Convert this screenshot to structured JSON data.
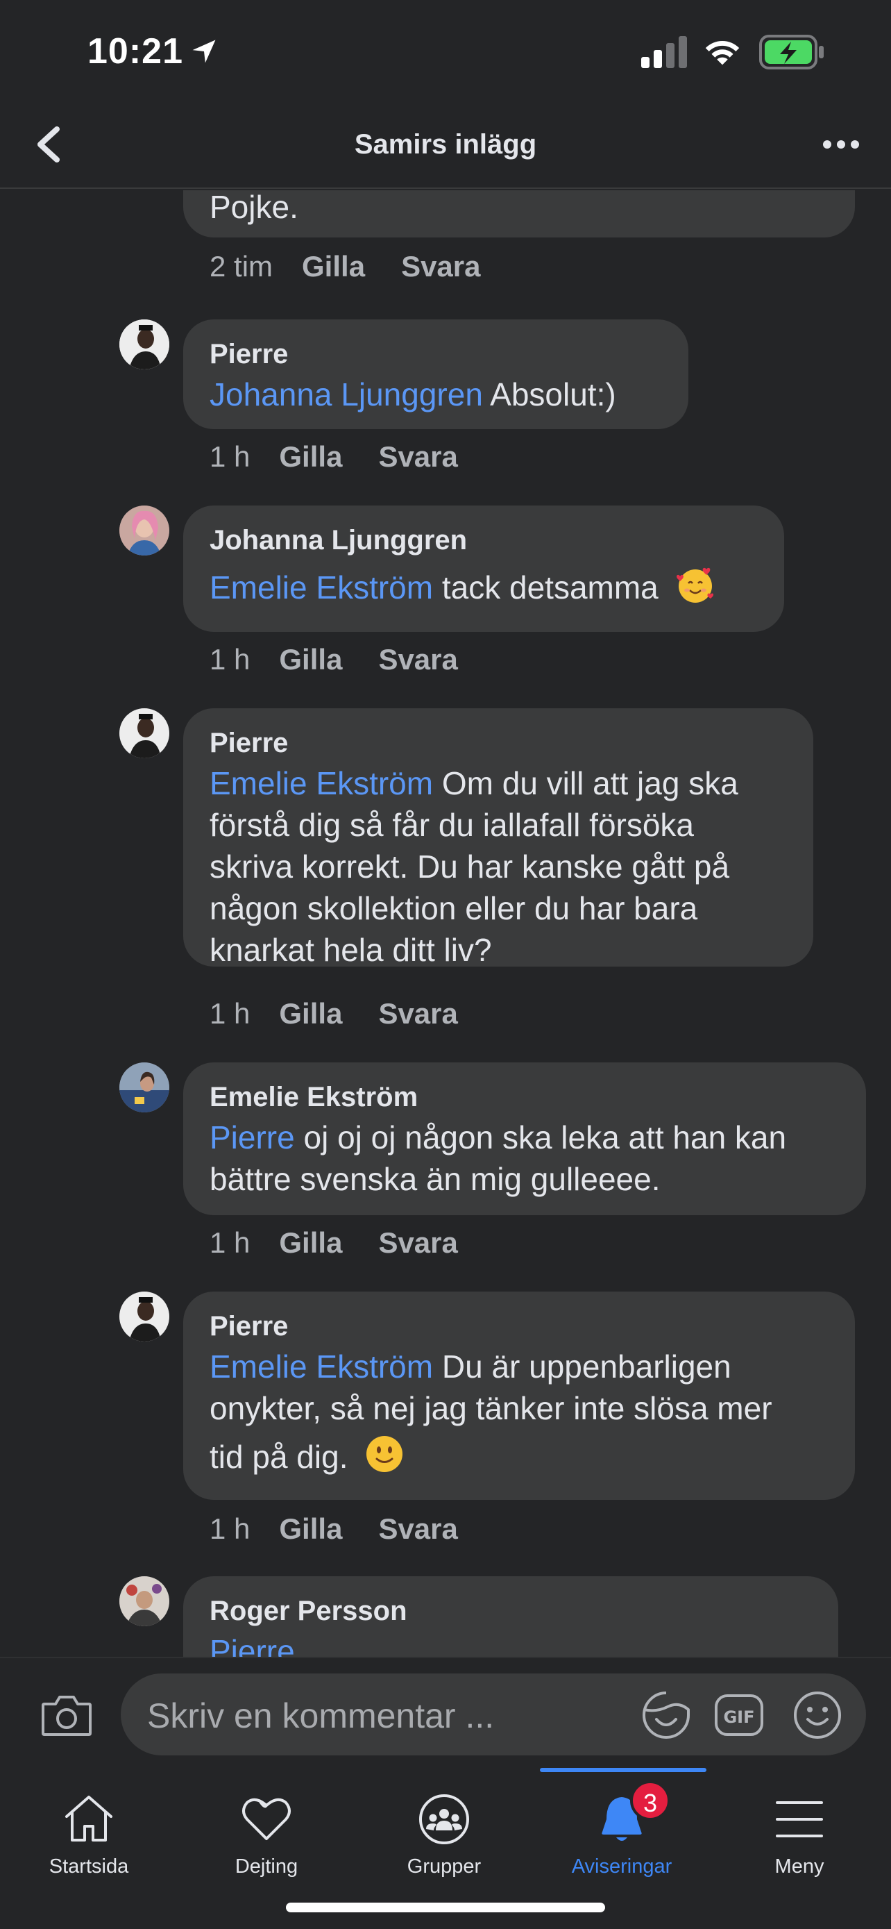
{
  "status_bar": {
    "time": "10:21"
  },
  "header": {
    "title": "Samirs inlägg"
  },
  "comments": [
    {
      "name": "",
      "mention": "",
      "text": "Pojke.",
      "time": "2 tim",
      "like": "Gilla",
      "reply": "Svara"
    },
    {
      "name": "Pierre",
      "mention": "Johanna Ljunggren",
      "text": " Absolut:)",
      "time": "1 h",
      "like": "Gilla",
      "reply": "Svara"
    },
    {
      "name": "Johanna Ljunggren",
      "mention": "Emelie Ekström",
      "text": " tack detsamma",
      "emoji": "smiling-face-with-hearts",
      "time": "1 h",
      "like": "Gilla",
      "reply": "Svara"
    },
    {
      "name": "Pierre",
      "mention": "Emelie Ekström",
      "lines": [
        " Om du vill att jag ska",
        "förstå dig så får du iallafall försöka",
        "skriva korrekt. Du har kanske gått på",
        "någon skollektion eller du har bara",
        "knarkat hela ditt liv?"
      ],
      "time": "1 h",
      "like": "Gilla",
      "reply": "Svara"
    },
    {
      "name": "Emelie Ekström",
      "mention": "Pierre",
      "lines": [
        " oj oj oj någon ska leka att han kan",
        "bättre svenska än mig gulleeee."
      ],
      "time": "1 h",
      "like": "Gilla",
      "reply": "Svara"
    },
    {
      "name": "Pierre",
      "mention": "Emelie Ekström",
      "lines": [
        " Du är uppenbarligen",
        "onykter, så nej jag tänker inte slösa mer",
        "tid på dig."
      ],
      "emoji": "slightly-smiling-face",
      "time": "1 h",
      "like": "Gilla",
      "reply": "Svara"
    },
    {
      "name": "Roger Persson",
      "mention": "Pierre"
    }
  ],
  "composer": {
    "placeholder": "Skriv en kommentar ..."
  },
  "tabs": [
    {
      "label": "Startsida",
      "icon": "home-icon"
    },
    {
      "label": "Dejting",
      "icon": "heart-icon"
    },
    {
      "label": "Grupper",
      "icon": "groups-icon"
    },
    {
      "label": "Aviseringar",
      "icon": "bell-icon",
      "badge": "3",
      "active": true
    },
    {
      "label": "Meny",
      "icon": "menu-icon"
    }
  ],
  "colors": {
    "background": "#242527",
    "bubble": "#3a3b3c",
    "mention": "#5b97f5",
    "accent": "#3e87f6",
    "badge": "#e41e3f"
  }
}
